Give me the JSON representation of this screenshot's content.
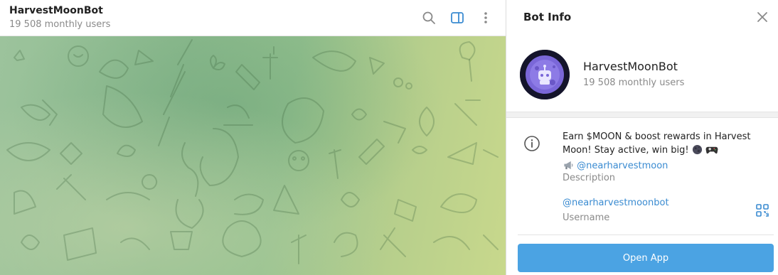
{
  "chat": {
    "title": "HarvestMoonBot",
    "subtitle": "19 508 monthly users",
    "icons": [
      "search-icon",
      "sidebar-toggle-icon",
      "more-vertical-icon"
    ],
    "accent": "#3a8bd1"
  },
  "info_panel": {
    "title": "Bot Info",
    "name": "HarvestMoonBot",
    "subtitle": "19 508 monthly users",
    "description_line1": "Earn $MOON & boost rewards in Harvest",
    "description_line2": "Moon! Stay active, win big!",
    "description_link": "@nearharvestmoon",
    "description_label": "Description",
    "username": "@nearharvestmoonbot",
    "username_label": "Username",
    "open_app_label": "Open App",
    "button_color": "#4ba3e3"
  }
}
